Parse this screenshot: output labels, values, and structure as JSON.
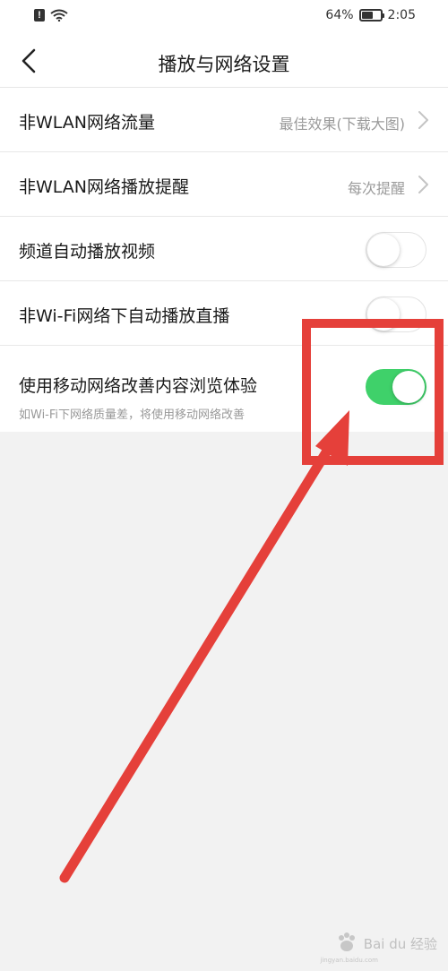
{
  "status_bar": {
    "battery_level": "64%",
    "battery_fraction": 0.64,
    "time": "2:05",
    "left_icons": [
      "alert-icon",
      "wifi-icon"
    ]
  },
  "header": {
    "title": "播放与网络设置",
    "back_icon": "chevron-left-icon"
  },
  "settings": [
    {
      "label": "非WLAN网络流量",
      "value": "最佳效果(下载大图)",
      "type": "nav"
    },
    {
      "label": "非WLAN网络播放提醒",
      "value": "每次提醒",
      "type": "nav"
    },
    {
      "label": "频道自动播放视频",
      "type": "toggle",
      "on": false
    },
    {
      "label": "非Wi-Fi网络下自动播放直播",
      "type": "toggle",
      "on": false
    },
    {
      "label": "使用移动网络改善内容浏览体验",
      "sublabel": "如Wi-Fi下网络质量差，将使用移动网络改善",
      "type": "toggle",
      "on": true
    }
  ],
  "colors": {
    "accent_green": "#3fd16a",
    "annotation_red": "#e5403a",
    "background": "#f2f2f2"
  },
  "watermark": {
    "text": "Bai du 经验",
    "sub": "jingyan.baidu.com"
  }
}
